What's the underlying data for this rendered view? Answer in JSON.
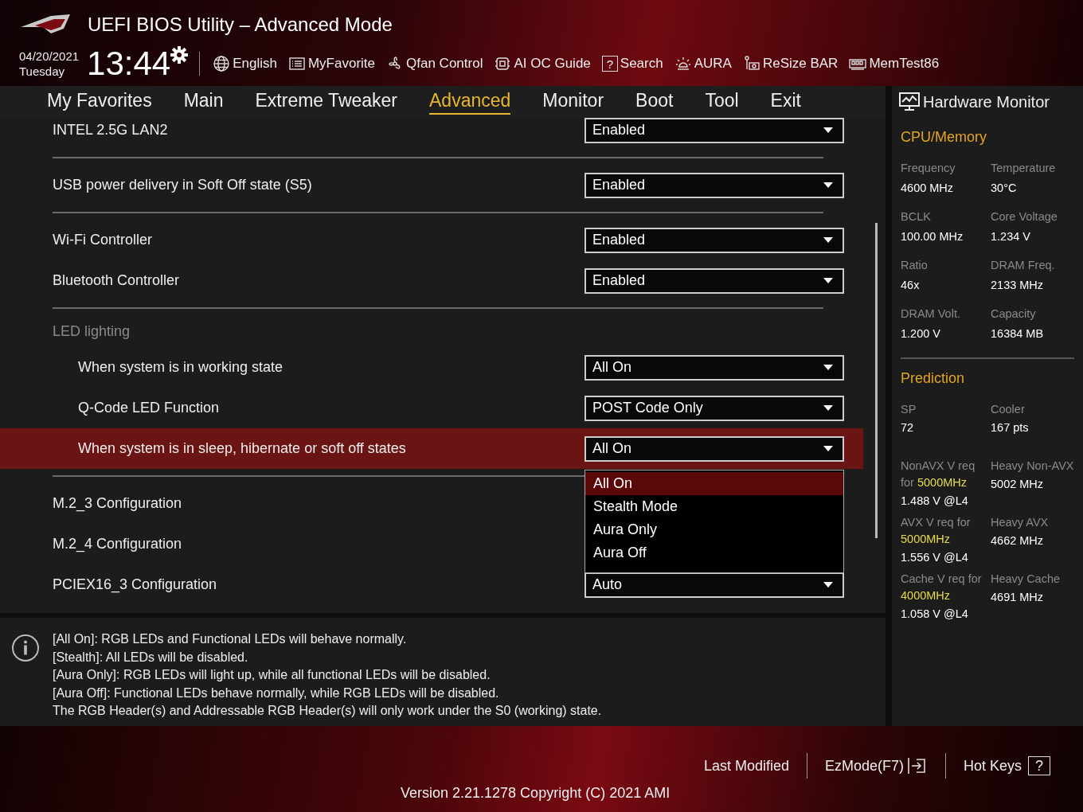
{
  "header": {
    "title": "UEFI BIOS Utility – Advanced Mode",
    "date": "04/20/2021",
    "day": "Tuesday",
    "time": "13:44",
    "tools": [
      {
        "label": "English",
        "kind": "globe"
      },
      {
        "label": "MyFavorite",
        "kind": "favorite"
      },
      {
        "label": "Qfan Control",
        "kind": "fan"
      },
      {
        "label": "AI OC Guide",
        "kind": "chip"
      },
      {
        "label": "Search",
        "kind": "help",
        "icon": "?"
      },
      {
        "label": "AURA",
        "kind": "aura"
      },
      {
        "label": "ReSize BAR",
        "kind": "card"
      },
      {
        "label": "MemTest86",
        "kind": "memory"
      }
    ]
  },
  "tabs": [
    {
      "label": "My Favorites",
      "selected": false
    },
    {
      "label": "Main",
      "selected": false
    },
    {
      "label": "Extreme Tweaker",
      "selected": false
    },
    {
      "label": "Advanced",
      "selected": true
    },
    {
      "label": "Monitor",
      "selected": false
    },
    {
      "label": "Boot",
      "selected": false
    },
    {
      "label": "Tool",
      "selected": false
    },
    {
      "label": "Exit",
      "selected": false
    }
  ],
  "settings": [
    {
      "rows": [
        {
          "kind": "setting",
          "label": "INTEL 2.5G LAN2",
          "value": "Enabled",
          "selected": false
        }
      ]
    },
    {
      "rows": [
        {
          "kind": "setting",
          "label": "USB power delivery in Soft Off state (S5)",
          "value": "Enabled",
          "selected": false
        }
      ]
    },
    {
      "rows": [
        {
          "kind": "setting",
          "label": "Wi-Fi Controller",
          "value": "Enabled",
          "selected": false
        },
        {
          "kind": "setting",
          "label": "Bluetooth Controller",
          "value": "Enabled",
          "selected": false
        }
      ]
    },
    {
      "rows": [
        {
          "kind": "heading",
          "label": "LED lighting",
          "children": [
            {
              "kind": "setting",
              "label": "When system is in working state",
              "value": "All On",
              "selected": false
            },
            {
              "kind": "setting",
              "label": "Q-Code LED Function",
              "value": "POST Code Only",
              "selected": false
            },
            {
              "kind": "setting",
              "label": "When system is in sleep, hibernate or soft off states",
              "value": "All On",
              "selected": true,
              "open": true,
              "options": [
                {
                  "label": "All On",
                  "selected": true
                },
                {
                  "label": "Stealth Mode",
                  "selected": false
                },
                {
                  "label": "Aura Only",
                  "selected": false
                },
                {
                  "label": "Aura Off",
                  "selected": false
                }
              ]
            }
          ]
        }
      ]
    },
    {
      "rows": [
        {
          "kind": "setting",
          "label": "M.2_3 Configuration",
          "selected": false
        },
        {
          "kind": "setting",
          "label": "M.2_4 Configuration",
          "selected": false
        },
        {
          "kind": "setting",
          "label": "PCIEX16_3 Configuration",
          "value": "Auto",
          "selected": false
        }
      ]
    }
  ],
  "help": {
    "lines": [
      "[All On]: RGB LEDs and Functional LEDs will behave normally.",
      "[Stealth]: All LEDs will be disabled.",
      "[Aura Only]: RGB LEDs will light up, while all functional LEDs will be disabled.",
      "[Aura Off]: Functional LEDs behave normally, while RGB LEDs will be disabled.",
      "The RGB Header(s) and Addressable RGB Header(s) will only work under the S0 (working) state."
    ]
  },
  "hardware_monitor": {
    "title": "Hardware Monitor",
    "sections": [
      {
        "title": "CPU/Memory",
        "items": [
          {
            "label": "Frequency",
            "value": "4600 MHz"
          },
          {
            "label": "Temperature",
            "value": "30°C"
          },
          {
            "label": "BCLK",
            "value": "100.00 MHz"
          },
          {
            "label": "Core Voltage",
            "value": "1.234 V"
          },
          {
            "label": "Ratio",
            "value": "46x"
          },
          {
            "label": "DRAM Freq.",
            "value": "2133 MHz"
          },
          {
            "label": "DRAM Volt.",
            "value": "1.200 V"
          },
          {
            "label": "Capacity",
            "value": "16384 MB"
          }
        ]
      },
      {
        "title": "Prediction",
        "items": [
          {
            "label": "SP",
            "value": "72"
          },
          {
            "label": "Cooler",
            "value": "167 pts"
          },
          {
            "label": "NonAVX V req for **5000MHz**",
            "value": "1.488 V @L4"
          },
          {
            "label": "Heavy Non-AVX",
            "value": "5002 MHz"
          },
          {
            "label": "AVX V req for **5000MHz**",
            "value": "1.556 V @L4"
          },
          {
            "label": "Heavy AVX",
            "value": "4662 MHz"
          },
          {
            "label": "Cache V req for **4000MHz**",
            "value": "1.058 V @L4"
          },
          {
            "label": "Heavy Cache",
            "value": "4691 MHz"
          }
        ]
      }
    ]
  },
  "footer": {
    "actions": [
      {
        "label": "Last Modified",
        "kind": "text"
      },
      {
        "label": "EzMode(F7)",
        "kind": "exit"
      },
      {
        "label": "Hot Keys",
        "kind": "help",
        "icon": "?"
      }
    ],
    "version": "Version 2.21.1278 Copyright (C) 2021 AMI"
  }
}
